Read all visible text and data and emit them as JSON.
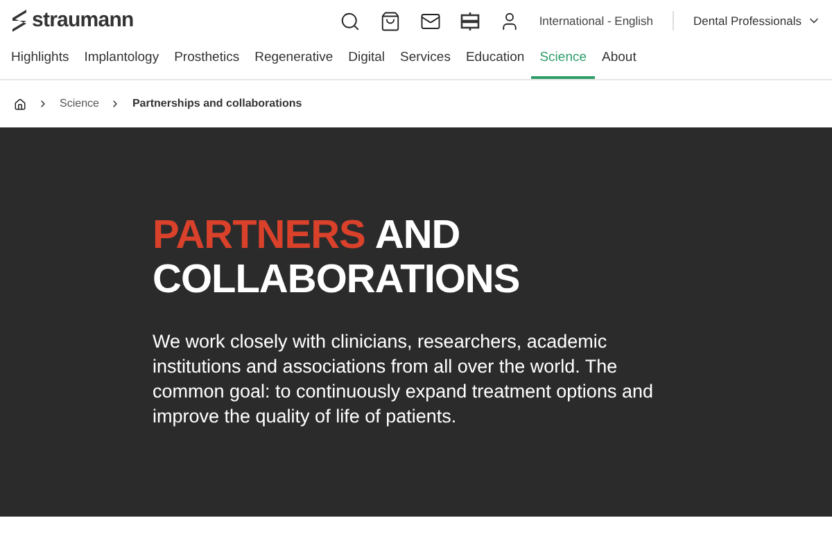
{
  "header": {
    "logo": "straumann",
    "region": "International - English",
    "audience": "Dental Professionals"
  },
  "nav": [
    {
      "label": "Highlights",
      "selected": false
    },
    {
      "label": "Implantology",
      "selected": false
    },
    {
      "label": "Prosthetics",
      "selected": false
    },
    {
      "label": "Regenerative",
      "selected": false
    },
    {
      "label": "Digital",
      "selected": false
    },
    {
      "label": "Services",
      "selected": false
    },
    {
      "label": "Education",
      "selected": false
    },
    {
      "label": "Science",
      "selected": true
    },
    {
      "label": "About",
      "selected": false
    }
  ],
  "breadcrumb": [
    "Science",
    "Partnerships and collaborations"
  ],
  "hero": {
    "title_highlight": "PARTNERS",
    "title_rest": "AND",
    "title_line2": "COLLABORATIONS",
    "text": "We work closely with clinicians, researchers, academic institutions and associations from all over the world. The common goal: to continuously expand treatment options and improve the quality of life of patients."
  }
}
